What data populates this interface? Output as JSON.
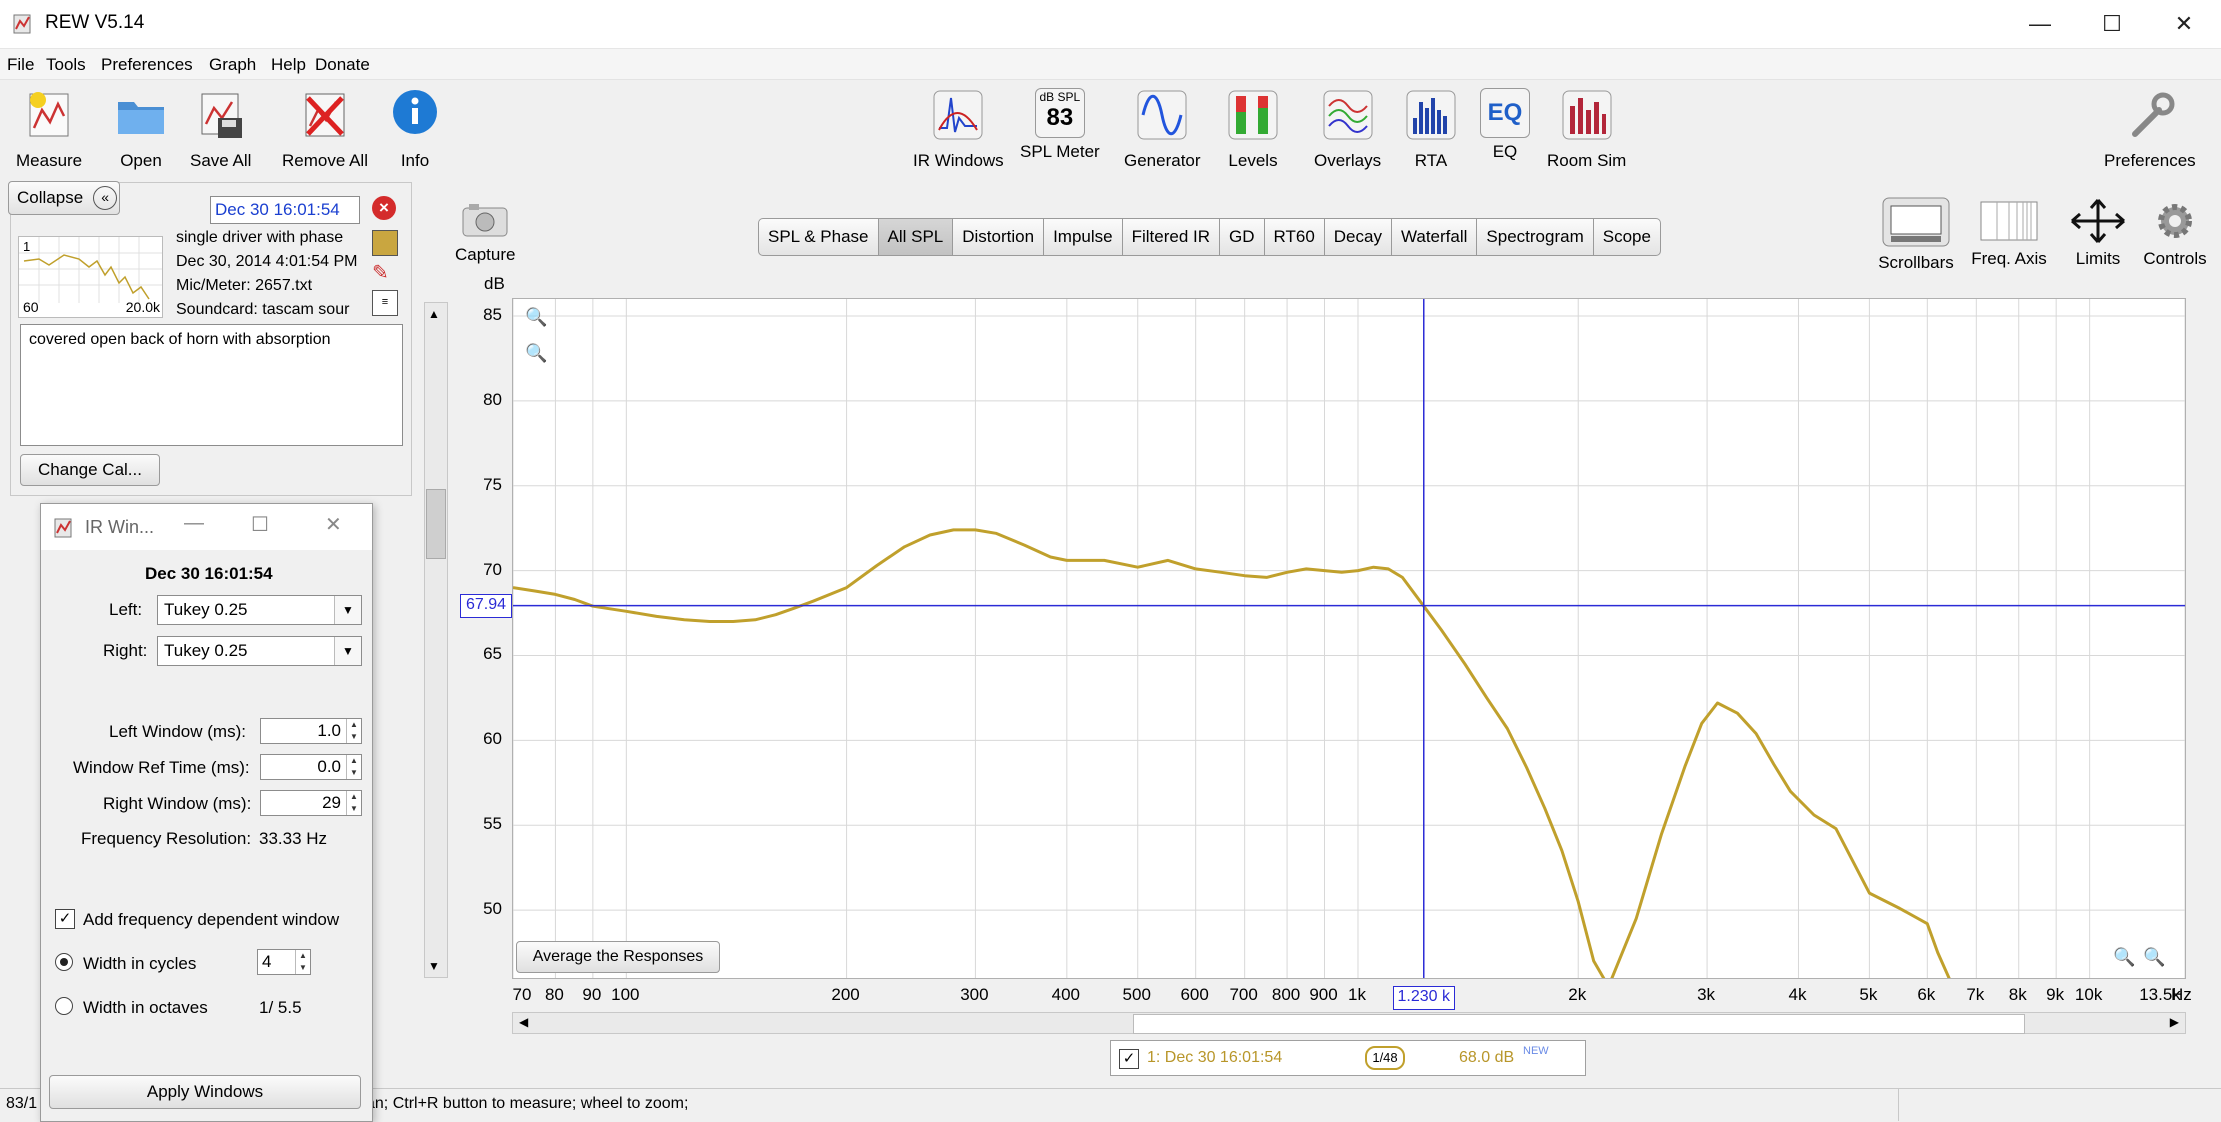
{
  "window": {
    "title": "REW V5.14"
  },
  "menu": [
    {
      "label": "File"
    },
    {
      "label": "Tools"
    },
    {
      "label": "Preferences"
    },
    {
      "label": "Graph"
    },
    {
      "label": "Help"
    },
    {
      "label": "Donate"
    }
  ],
  "toolbar": {
    "measure": "Measure",
    "open": "Open",
    "save_all": "Save All",
    "remove_all": "Remove All",
    "info": "Info",
    "ir_windows": "IR Windows",
    "spl_meter": "SPL Meter",
    "spl_meter_unit": "dB SPL",
    "spl_meter_value": "83",
    "generator": "Generator",
    "levels": "Levels",
    "overlays": "Overlays",
    "rta": "RTA",
    "eq": "EQ",
    "eq_icon_text": "EQ",
    "room_sim": "Room Sim",
    "preferences": "Preferences"
  },
  "graph_controls": {
    "capture": "Capture",
    "scrollbars": "Scrollbars",
    "freq_axis": "Freq. Axis",
    "limits": "Limits",
    "controls": "Controls"
  },
  "measurement_panel": {
    "collapse": "Collapse",
    "name_field": "Dec 30 16:01:54",
    "thumb_label": "1",
    "thumb_x_min": "60",
    "thumb_x_max": "20.0k",
    "info_lines": [
      "single driver with phase",
      "Dec 30, 2014 4:01:54 PM",
      "Mic/Meter: 2657.txt",
      "Soundcard: tascam sour"
    ],
    "notes": "covered open back of horn with absorption",
    "change_cal": "Change Cal..."
  },
  "ir_dialog": {
    "title": "IR Win...",
    "measurement": "Dec 30 16:01:54",
    "left_label": "Left:",
    "left_value": "Tukey 0.25",
    "right_label": "Right:",
    "right_value": "Tukey 0.25",
    "left_window_label": "Left Window (ms):",
    "left_window_value": "1.0",
    "ref_time_label": "Window Ref Time (ms):",
    "ref_time_value": "0.0",
    "right_window_label": "Right Window (ms):",
    "right_window_value": "29",
    "freq_res_label": "Frequency Resolution:",
    "freq_res_value": "33.33 Hz",
    "fdw_label": "Add frequency dependent window",
    "fdw_checked": true,
    "cycles_label": "Width in cycles",
    "cycles_value": "4",
    "octaves_label": "Width in octaves",
    "octaves_value": "1/ 5.5",
    "apply": "Apply Windows"
  },
  "tabs": [
    {
      "label": "SPL & Phase",
      "active": false
    },
    {
      "label": "All SPL",
      "active": true
    },
    {
      "label": "Distortion",
      "active": false
    },
    {
      "label": "Impulse",
      "active": false
    },
    {
      "label": "Filtered IR",
      "active": false
    },
    {
      "label": "GD",
      "active": false
    },
    {
      "label": "RT60",
      "active": false
    },
    {
      "label": "Decay",
      "active": false
    },
    {
      "label": "Waterfall",
      "active": false
    },
    {
      "label": "Spectrogram",
      "active": false
    },
    {
      "label": "Scope",
      "active": false
    }
  ],
  "graph": {
    "y_unit": "dB",
    "x_unit": "Hz",
    "cursor_y_readout": "67.94",
    "cursor_x_readout": "1.230 k",
    "average_button": "Average the Responses",
    "legend_label": "1: Dec 30 16:01:54",
    "legend_smoothing": "1/48",
    "legend_level": "68.0 dB",
    "legend_new": "NEW"
  },
  "status": {
    "left": "83/1",
    "hint": "an; Ctrl+R button to measure; wheel to zoom;"
  },
  "colors": {
    "trace": "#c0a02c",
    "cursor": "#2b2bd6",
    "grid": "#d8d8d8"
  },
  "chart_data": {
    "type": "line",
    "x_scale": "log",
    "xlim": [
      70,
      13500
    ],
    "ylim": [
      46,
      86
    ],
    "ylabel": "dB",
    "xlabel": "Hz",
    "y_ticks": [
      "85",
      "80",
      "75",
      "70",
      "65",
      "60",
      "55",
      "50"
    ],
    "x_ticks": [
      {
        "v": 70,
        "t": "70"
      },
      {
        "v": 80,
        "t": "80"
      },
      {
        "v": 90,
        "t": "90"
      },
      {
        "v": 100,
        "t": "100"
      },
      {
        "v": 200,
        "t": "200"
      },
      {
        "v": 300,
        "t": "300"
      },
      {
        "v": 400,
        "t": "400"
      },
      {
        "v": 500,
        "t": "500"
      },
      {
        "v": 600,
        "t": "600"
      },
      {
        "v": 700,
        "t": "700"
      },
      {
        "v": 800,
        "t": "800"
      },
      {
        "v": 900,
        "t": "900"
      },
      {
        "v": 1000,
        "t": "1k"
      },
      {
        "v": 2000,
        "t": "2k"
      },
      {
        "v": 3000,
        "t": "3k"
      },
      {
        "v": 4000,
        "t": "4k"
      },
      {
        "v": 5000,
        "t": "5k"
      },
      {
        "v": 6000,
        "t": "6k"
      },
      {
        "v": 7000,
        "t": "7k"
      },
      {
        "v": 8000,
        "t": "8k"
      },
      {
        "v": 9000,
        "t": "9k"
      },
      {
        "v": 10000,
        "t": "10k"
      },
      {
        "v": 13500,
        "t": "13.5k"
      }
    ],
    "series": [
      {
        "name": "1: Dec 30 16:01:54",
        "x": [
          70,
          75,
          80,
          85,
          90,
          100,
          110,
          120,
          130,
          140,
          150,
          160,
          170,
          180,
          200,
          220,
          240,
          260,
          280,
          300,
          320,
          350,
          380,
          400,
          450,
          500,
          550,
          600,
          650,
          700,
          750,
          800,
          850,
          900,
          950,
          1000,
          1050,
          1100,
          1150,
          1230,
          1300,
          1400,
          1500,
          1600,
          1700,
          1800,
          1900,
          2000,
          2100,
          2200,
          2400,
          2600,
          2800,
          2950,
          3100,
          3300,
          3500,
          3700,
          3900,
          4200,
          4500,
          5000,
          5500,
          6000,
          6200,
          6500
        ],
        "y": [
          69,
          68.8,
          68.6,
          68.3,
          67.9,
          67.6,
          67.3,
          67.1,
          67.0,
          67.0,
          67.1,
          67.4,
          67.8,
          68.2,
          69.0,
          70.3,
          71.4,
          72.1,
          72.4,
          72.4,
          72.2,
          71.5,
          70.8,
          70.6,
          70.6,
          70.2,
          70.6,
          70.1,
          69.9,
          69.7,
          69.6,
          69.9,
          70.1,
          70.0,
          69.9,
          70.0,
          70.2,
          70.1,
          69.6,
          67.9,
          66.5,
          64.5,
          62.5,
          60.7,
          58.4,
          56.0,
          53.5,
          50.5,
          47.0,
          45.5,
          49.5,
          54.5,
          58.5,
          61.0,
          62.2,
          61.6,
          60.4,
          58.6,
          57.0,
          55.6,
          54.8,
          51.0,
          50.1,
          49.2,
          47.5,
          45.5
        ]
      }
    ],
    "cursor": {
      "x": 1230,
      "y": 67.94
    },
    "grid": true
  }
}
